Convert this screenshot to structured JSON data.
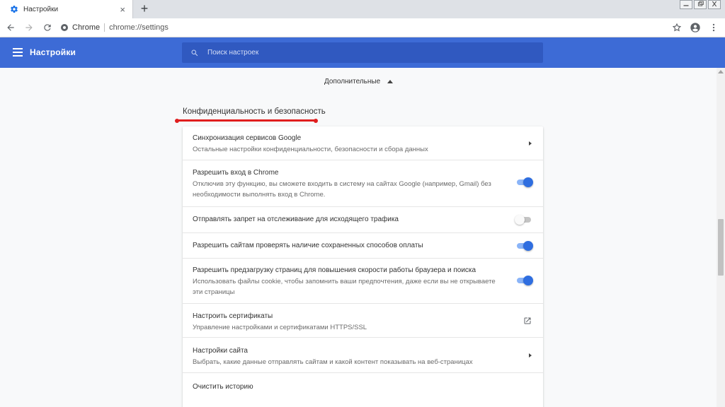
{
  "browser": {
    "tab_title": "Настройки",
    "tab_close": "×",
    "new_tab": "+",
    "chip_label": "Chrome",
    "url": "chrome://settings"
  },
  "header": {
    "title": "Настройки",
    "search_placeholder": "Поиск настроек"
  },
  "content": {
    "advanced_label": "Дополнительные",
    "section_title": "Конфиденциальность и безопасность",
    "rows": [
      {
        "title": "Синхронизация сервисов Google",
        "subtitle": "Остальные настройки конфиденциальности, безопасности и сбора данных",
        "control": "arrow"
      },
      {
        "title": "Разрешить вход в Chrome",
        "subtitle": "Отключив эту функцию, вы сможете входить в систему на сайтах Google (например, Gmail) без необходимости выполнять вход в Chrome.",
        "control": "toggle",
        "enabled": true
      },
      {
        "title": "Отправлять запрет на отслеживание для исходящего трафика",
        "subtitle": "",
        "control": "toggle",
        "enabled": false
      },
      {
        "title": "Разрешить сайтам проверять наличие сохраненных способов оплаты",
        "subtitle": "",
        "control": "toggle",
        "enabled": true
      },
      {
        "title": "Разрешить предзагрузку страниц для повышения скорости работы браузера и поиска",
        "subtitle": "Использовать файлы cookie, чтобы запомнить ваши предпочтения, даже если вы не открываете эти страницы",
        "control": "toggle",
        "enabled": true
      },
      {
        "title": "Настроить сертификаты",
        "subtitle": "Управление настройками и сертификатами HTTPS/SSL",
        "control": "external"
      },
      {
        "title": "Настройки сайта",
        "subtitle": "Выбрать, какие данные отправлять сайтам и какой контент показывать на веб-страницах",
        "control": "arrow"
      },
      {
        "title": "Очистить историю",
        "subtitle": "",
        "control": "none"
      }
    ]
  },
  "colors": {
    "header_blue": "#3d6bd6",
    "search_blue": "#3059c0",
    "toggle_on": "#2f6ee0",
    "annotation_red": "#e01e1e"
  },
  "icons": {
    "tab": "gear-icon",
    "back": "arrow-left-icon",
    "forward": "arrow-right-icon",
    "reload": "reload-icon",
    "bookmark": "star-icon",
    "profile": "account-circle-icon",
    "menu": "more-vert-icon",
    "search": "search-icon",
    "external": "open-in-new-icon"
  }
}
